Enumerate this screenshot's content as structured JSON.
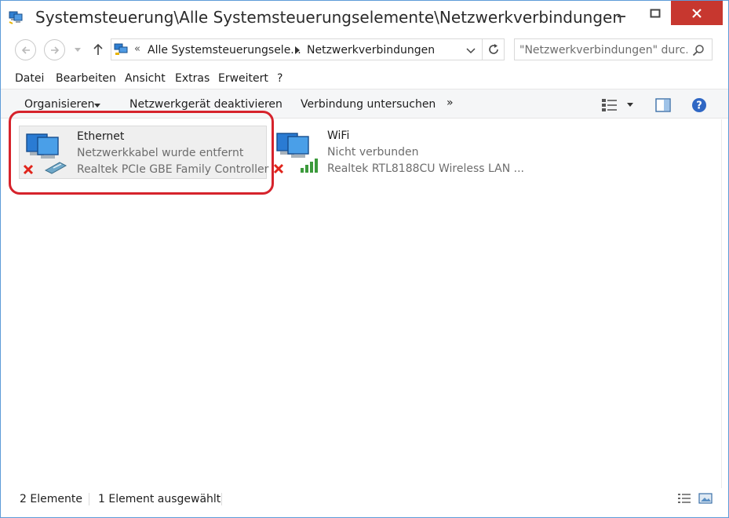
{
  "window": {
    "title": "Systemsteuerung\\Alle Systemsteuerungselemente\\Netzwerkverbindungen",
    "close_color": "#c7372f"
  },
  "address": {
    "overflow": "«",
    "crumb_parent": "Alle Systemsteuerungsele...",
    "crumb_current": "Netzwerkverbindungen"
  },
  "search": {
    "placeholder": "\"Netzwerkverbindungen\" durc..."
  },
  "menu": {
    "items": [
      "Datei",
      "Bearbeiten",
      "Ansicht",
      "Extras",
      "Erweitert",
      "?"
    ]
  },
  "commands": {
    "organize": "Organisieren",
    "disable": "Netzwerkgerät deaktivieren",
    "diagnose": "Verbindung untersuchen",
    "more": "»"
  },
  "connections": [
    {
      "name": "Ethernet",
      "status": "Netzwerkkabel wurde entfernt",
      "device": "Realtek PCIe GBE Family Controller",
      "selected": true,
      "icon": "ethernet-disconnected-icon"
    },
    {
      "name": "WiFi",
      "status": "Nicht verbunden",
      "device": "Realtek RTL8188CU Wireless LAN ...",
      "selected": false,
      "icon": "wifi-disconnected-icon"
    }
  ],
  "status": {
    "count": "2 Elemente",
    "selection": "1 Element ausgewählt"
  },
  "colors": {
    "highlight": "#d6232c",
    "selection_bg": "#efefef",
    "accent_blue": "#1e6fc0",
    "error_red": "#e0241b",
    "signal_green": "#3c9a3c"
  }
}
